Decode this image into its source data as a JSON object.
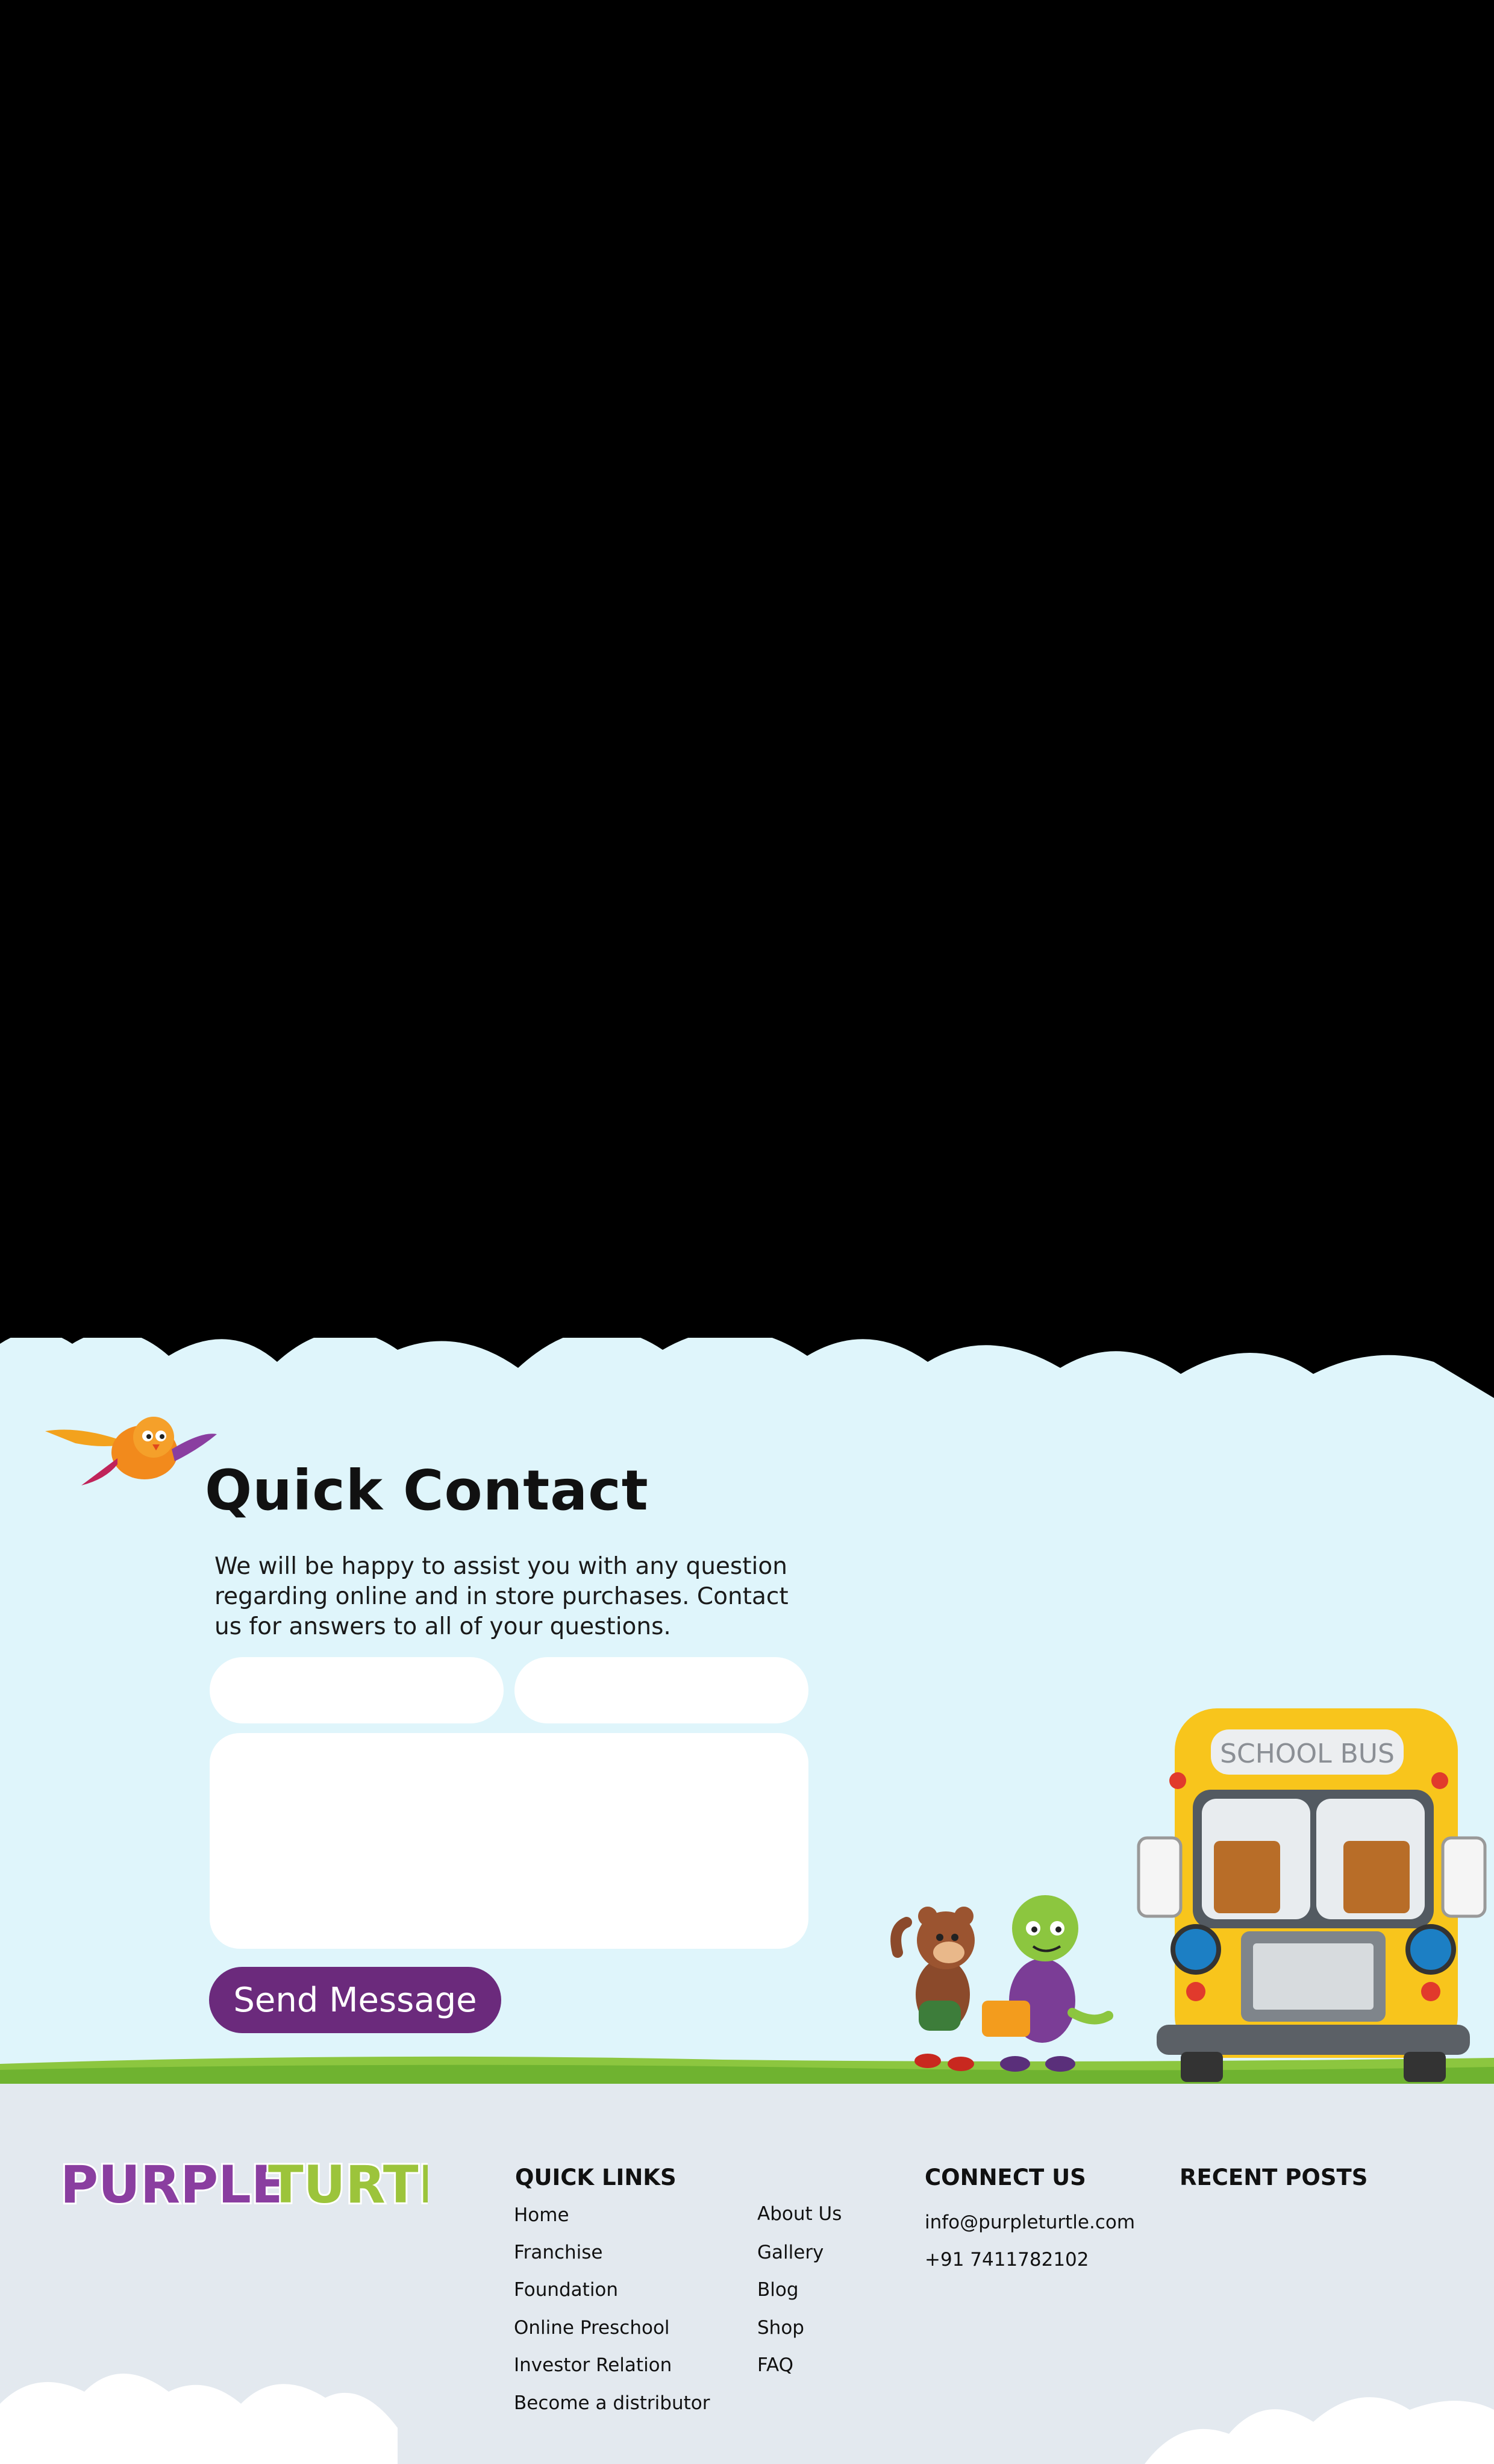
{
  "contact": {
    "title": "Quick Contact",
    "description": "We will be happy to assist you with any question regarding online and in store purchases. Contact us for answers to all of your questions.",
    "send_label": "Send Message"
  },
  "bus": {
    "sign": "SCHOOL BUS"
  },
  "footer": {
    "logo_text": "PURPLE TURTLE",
    "quick_links_heading": "QUICK LINKS",
    "quick_links_col1": [
      "Home",
      "Franchise",
      "Foundation",
      "Online Preschool",
      "Investor Relation",
      "Become a distributor"
    ],
    "quick_links_col2": [
      "About Us",
      "Gallery",
      "Blog",
      "Shop",
      "FAQ"
    ],
    "connect_heading": "CONNECT US",
    "email": "info@purpleturtle.com",
    "phone": "+91 7411782102",
    "recent_posts_heading": "RECENT POSTS"
  },
  "colors": {
    "sky": "#dff5fb",
    "button": "#6b2a7c",
    "grass": "#8cc63f",
    "footer_bg": "#e3e9ef",
    "logo_purple": "#8a3ea0",
    "logo_green": "#9cc43b"
  }
}
